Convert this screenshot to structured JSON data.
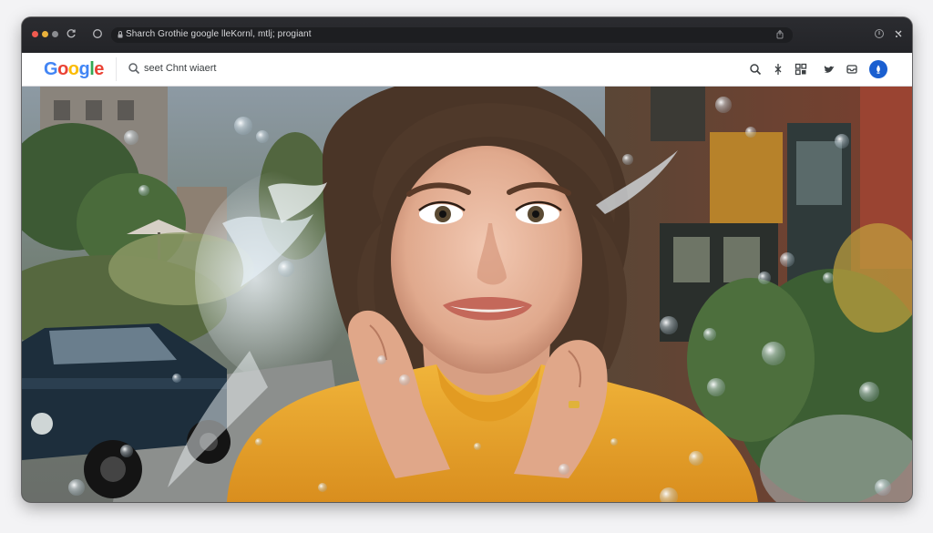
{
  "browser": {
    "address_text": "Sharch Grothie google lleKornl, mtlj; progiant"
  },
  "google_toolbar": {
    "logo_letters": [
      {
        "char": "G",
        "color": "#4285F4"
      },
      {
        "char": "o",
        "color": "#EA4335"
      },
      {
        "char": "o",
        "color": "#FBBC05"
      },
      {
        "char": "g",
        "color": "#4285F4"
      },
      {
        "char": "l",
        "color": "#34A853"
      },
      {
        "char": "e",
        "color": "#EA4335"
      }
    ],
    "search_placeholder": "seet Chnt wiaert",
    "icons": [
      "search-icon",
      "voice-icon",
      "apps-icon",
      "bird-icon",
      "inbox-icon",
      "account-avatar"
    ]
  },
  "colors": {
    "titlebar": "#2b2c30",
    "sweater": "#e8a72a",
    "accent_blue": "#1a5fd0"
  }
}
